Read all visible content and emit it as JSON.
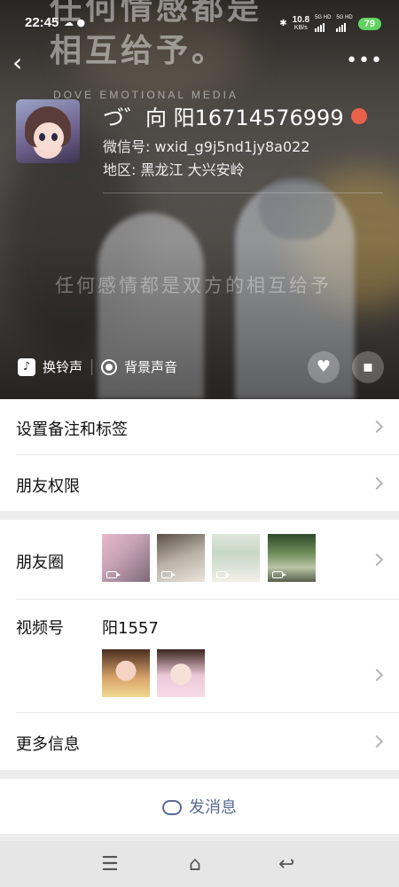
{
  "status_bar": {
    "time": "22:45",
    "net_speed": "10.8",
    "net_unit": "KB/s",
    "sim1": "5G HD",
    "sim2": "5G HD",
    "battery": "79"
  },
  "cover": {
    "big_text": "任何情感都是\n相互给予。",
    "big_line1": "任何情感都是",
    "big_line2": "相互给予。",
    "brand": "DOVE EMOTIONAL MEDIA",
    "caption": "任何感情都是双方的相互给予"
  },
  "profile": {
    "name": "づ゛向 阳16714576999",
    "wechat_id": "微信号: wxid_g9j5nd1jy8a022",
    "region": "地区: 黑龙江  大兴安岭"
  },
  "sound_bar": {
    "ringtone_label": "换铃声",
    "background_sound_label": "背景声音"
  },
  "menu": {
    "remark_tags": "设置备注和标签",
    "friend_permissions": "朋友权限",
    "moments": "朋友圈",
    "channels": "视频号",
    "channels_name": "阳1557",
    "more_info": "更多信息"
  },
  "actions": {
    "send_message": "发消息"
  },
  "icons": {
    "back": "chevron-left-icon",
    "more": "more-dots-icon",
    "like": "heart-icon",
    "message": "chat-bubble-icon",
    "nav_menu": "menu-icon",
    "nav_home": "home-icon",
    "nav_back": "return-icon"
  },
  "colors": {
    "link": "#576b95",
    "battery": "#5fd35f",
    "badge": "#e8614b"
  }
}
